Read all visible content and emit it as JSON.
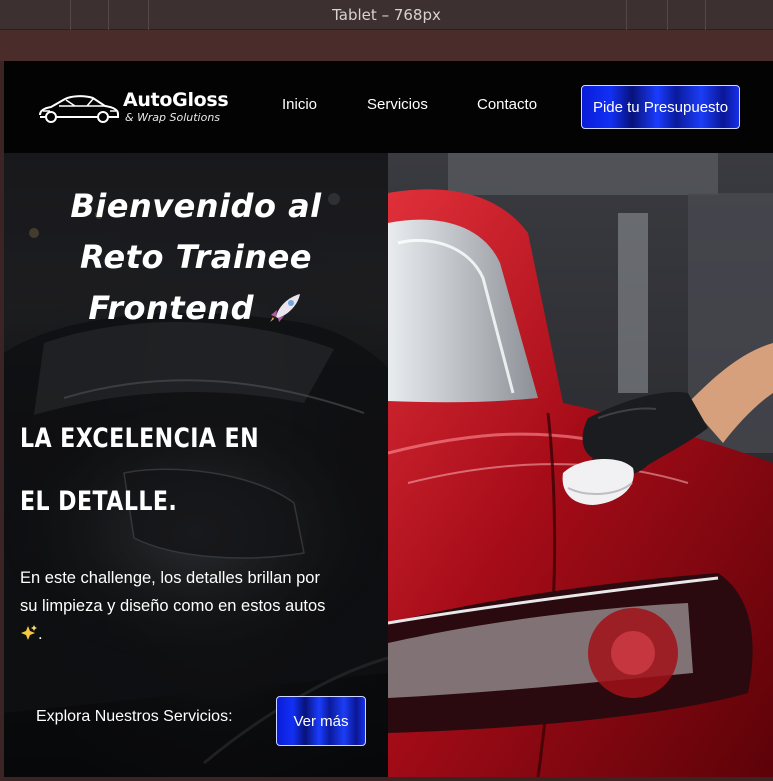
{
  "devtools": {
    "device_label": "Tablet – 768px"
  },
  "navbar": {
    "brand_name": "AutoGloss",
    "brand_tagline": "& Wrap Solutions",
    "links": [
      "Inicio",
      "Servicios",
      "Contacto"
    ],
    "cta_label": "Pide tu Presupuesto"
  },
  "hero": {
    "title": "Bienvenido al Reto Trainee Frontend",
    "title_icon": "rocket-icon",
    "subtitle": "LA EXCELENCIA EN EL DETALLE.",
    "text": "En este challenge, los detalles brillan por su limpieza y diseño como en estos autos",
    "text_icon": "sparkles-icon",
    "text_suffix": ".",
    "explore_label": "Explora Nuestros Servicios:",
    "explore_button": "Ver más"
  },
  "colors": {
    "button_blue": "#1130f5",
    "navbar_bg": "#030303",
    "car_red": "#b0101c"
  }
}
